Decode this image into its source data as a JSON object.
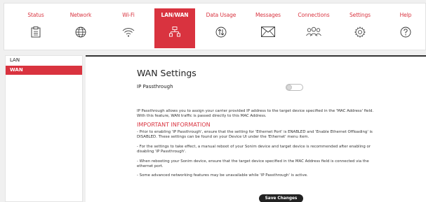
{
  "nav": {
    "tabs": [
      {
        "label": "Status",
        "icon": "clipboard-icon",
        "active": false
      },
      {
        "label": "Network",
        "icon": "globe-icon",
        "active": false
      },
      {
        "label": "Wi-Fi",
        "icon": "wifi-icon",
        "active": false
      },
      {
        "label": "LAN/WAN",
        "icon": "network-tree-icon",
        "active": true
      },
      {
        "label": "Data Usage",
        "icon": "data-usage-icon",
        "active": false
      },
      {
        "label": "Messages",
        "icon": "envelope-icon",
        "active": false
      },
      {
        "label": "Connections",
        "icon": "users-icon",
        "active": false
      },
      {
        "label": "Settings",
        "icon": "gear-icon",
        "active": false
      },
      {
        "label": "Help",
        "icon": "question-icon",
        "active": false
      }
    ]
  },
  "sidebar": {
    "items": [
      {
        "label": "LAN",
        "active": false
      },
      {
        "label": "WAN",
        "active": true
      }
    ]
  },
  "main": {
    "title": "WAN Settings",
    "ip_passthrough_label": "IP Passthrough",
    "ip_passthrough_enabled": false,
    "description": "IP Passthrough allows you to assign your carrier provided IP address to the target device specified in the 'MAC Address' field. With this feature, WAN traffic is passed directly to this MAC Address.",
    "important_heading": "IMPORTANT INFORMATION",
    "bullets": [
      "- Prior to enabling 'IP Passthrough', ensure that the setting for 'Ethernet Port' is ENABLED and 'Enable Ethernet Offloading' is DISABLED. These settings can be found on your Device UI under the 'Ethernet' menu item.",
      "- For the settings to take effect, a manual reboot of your Sonim device and target device is recommended after enabling or disabling 'IP Passthrough'.",
      "- When rebooting your Sonim device, ensure that the target device specified in the MAC Address field is connected via the ethernet port.",
      "- Some advanced networking features may be unavailable while 'IP Passthrough' is active."
    ],
    "save_label": "Save Changes"
  },
  "colors": {
    "accent": "#d9333f",
    "button": "#222222"
  }
}
